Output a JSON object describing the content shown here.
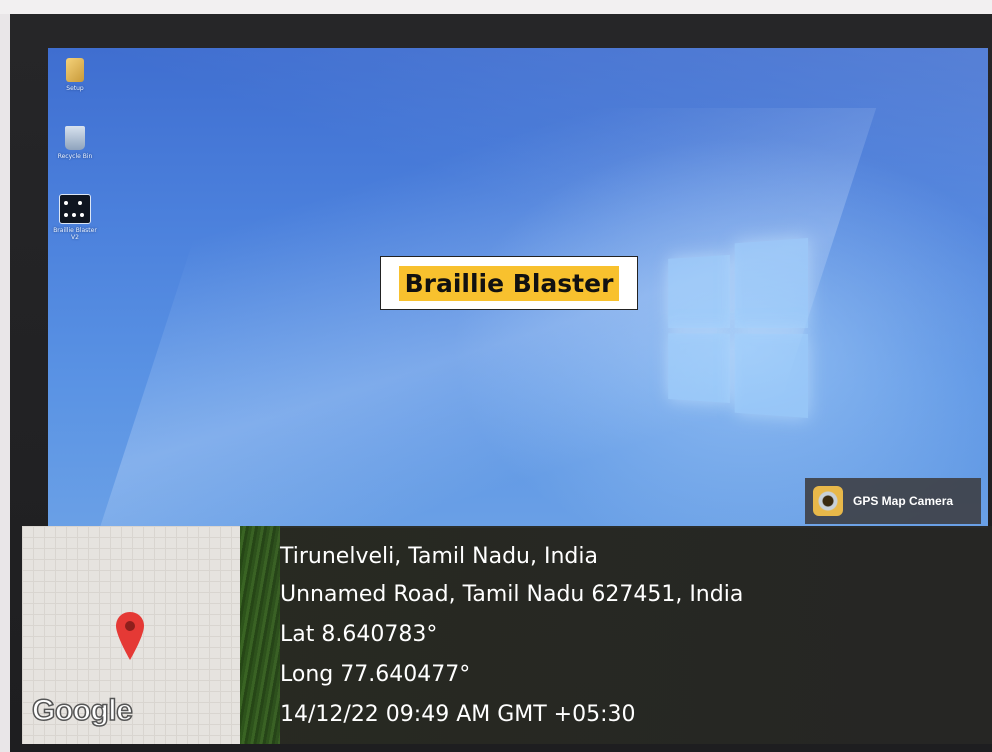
{
  "desktop": {
    "icons": [
      {
        "label": "Setup",
        "icon": "folder-icon"
      },
      {
        "label": "Recycle Bin",
        "icon": "recycle-bin-icon"
      },
      {
        "label": "Braillie Blaster V2",
        "icon": "app-shortcut-icon"
      }
    ],
    "app_title": "Braillie Blaster",
    "wallpaper_color": "#4b80dc",
    "title_highlight_color": "#f8c12e"
  },
  "gps_badge": {
    "label": "GPS Map Camera",
    "icon": "camera-lens-icon"
  },
  "map": {
    "brand": "Google",
    "pin_color": "#e53935",
    "pin_icon": "map-pin-icon"
  },
  "location": {
    "place": "Tirunelveli, Tamil Nadu, India",
    "address": "Unnamed Road, Tamil Nadu 627451, India",
    "lat": "Lat 8.640783°",
    "long": "Long 77.640477°",
    "datetime": "14/12/22 09:49 AM GMT +05:30"
  }
}
